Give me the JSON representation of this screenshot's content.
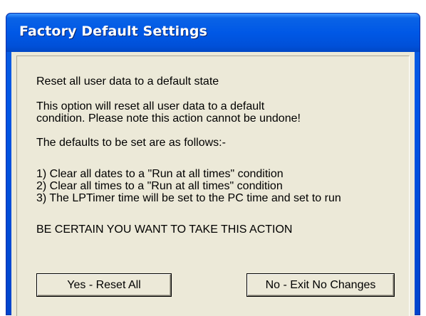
{
  "window": {
    "title": "Factory Default Settings"
  },
  "content": {
    "heading": "Reset all user data to a default state",
    "description_line1": "This option will reset all user data to a default",
    "description_line2": "condition. Please note this action cannot be undone!",
    "defaults_intro": "The defaults to be set are as follows:-",
    "defaults": [
      "1) Clear all dates to a \"Run at all times\" condition",
      "2) Clear all times to a \"Run at all times\" condition",
      "3) The LPTimer time will be set to the PC time and set to run"
    ],
    "warning": "BE CERTAIN YOU WANT TO TAKE THIS ACTION"
  },
  "buttons": {
    "yes_label": "Yes - Reset All",
    "no_label": "No - Exit No Changes"
  },
  "colors": {
    "titlebar": "#0058e6",
    "client_bg": "#ece9d8",
    "title_text": "#ffffff"
  }
}
